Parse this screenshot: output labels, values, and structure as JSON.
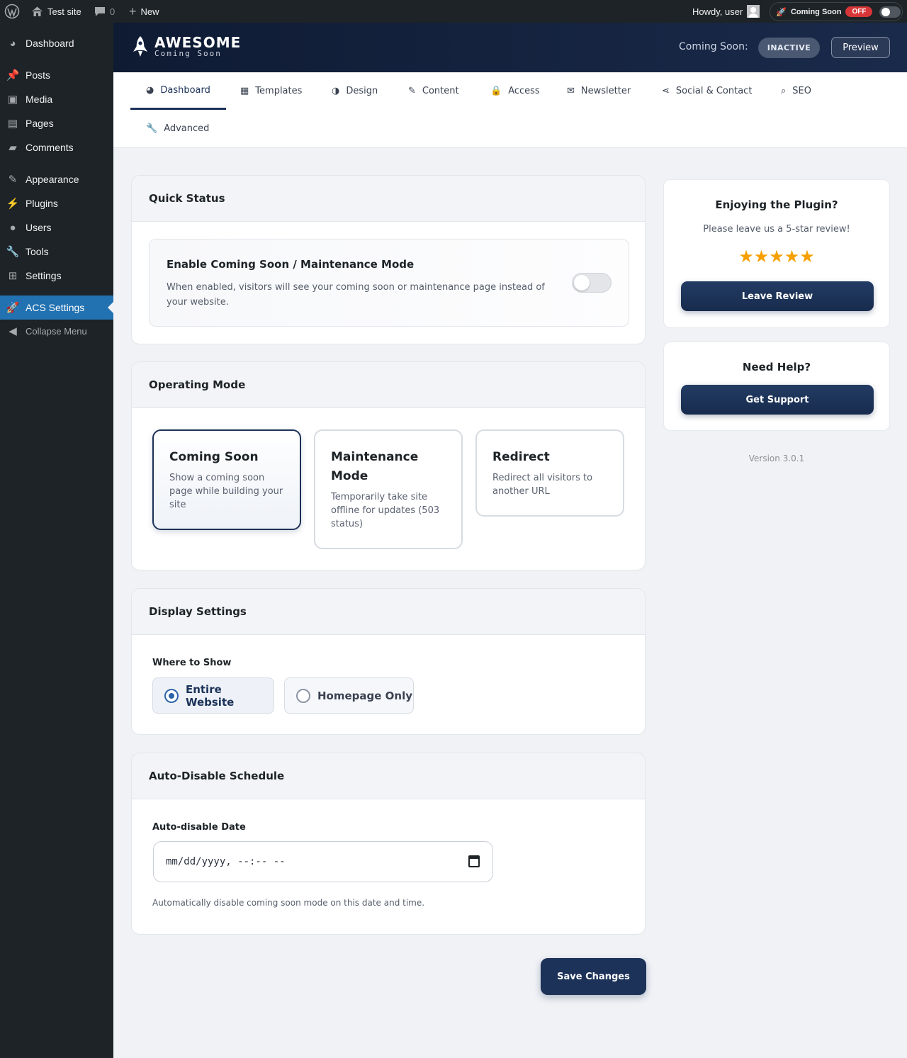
{
  "adminbar": {
    "site_name": "Test site",
    "comments_count": "0",
    "new_label": "New",
    "howdy": "Howdy, user",
    "cs_label": "Coming Soon",
    "cs_state": "OFF"
  },
  "sidebar": {
    "items": [
      {
        "label": "Dashboard",
        "icon": "dashboard-icon"
      },
      {
        "label": "Posts",
        "icon": "pin-icon"
      },
      {
        "label": "Media",
        "icon": "media-icon"
      },
      {
        "label": "Pages",
        "icon": "pages-icon"
      },
      {
        "label": "Comments",
        "icon": "comment-icon"
      },
      {
        "label": "Appearance",
        "icon": "brush-icon"
      },
      {
        "label": "Plugins",
        "icon": "plugin-icon"
      },
      {
        "label": "Users",
        "icon": "user-icon"
      },
      {
        "label": "Tools",
        "icon": "wrench-icon"
      },
      {
        "label": "Settings",
        "icon": "settings-icon"
      },
      {
        "label": "ACS Settings",
        "icon": "rocket-icon",
        "active": true
      }
    ],
    "collapse_label": "Collapse Menu"
  },
  "header": {
    "logo_title": "AWESOME",
    "logo_sub": "Coming Soon",
    "status_label": "Coming Soon:",
    "status_badge": "INACTIVE",
    "preview_label": "Preview"
  },
  "tabs": [
    {
      "label": "Dashboard",
      "icon": "gauge-icon",
      "active": true
    },
    {
      "label": "Templates",
      "icon": "grid-icon"
    },
    {
      "label": "Design",
      "icon": "palette-icon"
    },
    {
      "label": "Content",
      "icon": "pencil-icon"
    },
    {
      "label": "Access",
      "icon": "lock-icon"
    },
    {
      "label": "Newsletter",
      "icon": "envelope-icon"
    },
    {
      "label": "Social & Contact",
      "icon": "share-icon"
    },
    {
      "label": "SEO",
      "icon": "search-icon"
    },
    {
      "label": "Advanced",
      "icon": "wrench-icon"
    }
  ],
  "quick_status": {
    "title": "Quick Status",
    "toggle_title": "Enable Coming Soon / Maintenance Mode",
    "toggle_desc": "When enabled, visitors will see your coming soon or maintenance page instead of your website.",
    "enabled": false
  },
  "operating_mode": {
    "title": "Operating Mode",
    "modes": [
      {
        "title": "Coming Soon",
        "desc": "Show a coming soon page while building your site",
        "selected": true
      },
      {
        "title": "Maintenance Mode",
        "desc": "Temporarily take site offline for updates (503 status)",
        "selected": false
      },
      {
        "title": "Redirect",
        "desc": "Redirect all visitors to another URL",
        "selected": false
      }
    ]
  },
  "display_settings": {
    "title": "Display Settings",
    "where_label": "Where to Show",
    "options": [
      {
        "label": "Entire Website",
        "checked": true
      },
      {
        "label": "Homepage Only",
        "checked": false
      }
    ]
  },
  "schedule": {
    "title": "Auto-Disable Schedule",
    "field_label": "Auto-disable Date",
    "date_value": "mm/dd/yyyy, --:-- --",
    "help": "Automatically disable coming soon mode on this date and time."
  },
  "save_label": "Save Changes",
  "review_card": {
    "title": "Enjoying the Plugin?",
    "text": "Please leave us a 5-star review!",
    "stars": "★★★★★",
    "rating": 5,
    "button": "Leave Review"
  },
  "help_card": {
    "title": "Need Help?",
    "button": "Get Support"
  },
  "version": "Version 3.0.1",
  "colors": {
    "accent": "#1c3258",
    "admin_dark": "#1d2327",
    "active_menu": "#2271b1",
    "off_badge": "#d63638",
    "star": "#f5a000"
  }
}
